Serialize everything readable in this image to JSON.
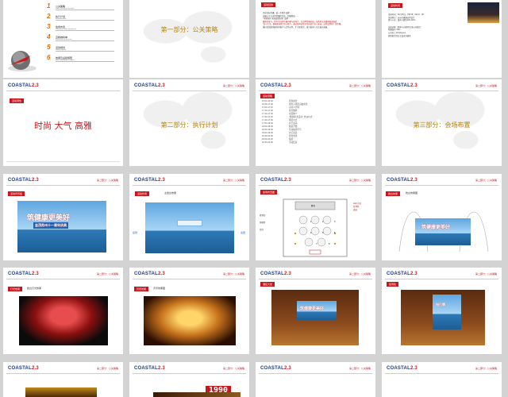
{
  "logo": {
    "main": "COASTAL",
    "suffix": "2.3"
  },
  "section_label": "第二部分：公关策略",
  "slide1": {
    "menu": [
      {
        "num": "1",
        "label": "公关策略",
        "sub": "Public Relations strategies"
      },
      {
        "num": "2",
        "label": "执行计划",
        "sub": "Implementation"
      },
      {
        "num": "3",
        "label": "会场布置",
        "sub": "Conference hall arrangement"
      },
      {
        "num": "4",
        "label": "宣教物料单",
        "sub": "Production of materials"
      },
      {
        "num": "5",
        "label": "活动规划",
        "sub": "Event program"
      },
      {
        "num": "6",
        "label": "效果及后勤保障",
        "sub": "Effect and logistics support"
      }
    ]
  },
  "slide2": {
    "title": "第一部分：公关策略"
  },
  "slide3": {
    "badge": "活动目的",
    "lines": [
      "活动目标传播：进一步提升品牌……",
      "加强公关与市场传播的互动，积极参加……",
      "\"中国海岸·滨海度假名城\" 品牌……",
      "媒体的参与，提升活动的传播声量与影响力，在品牌传播层面，由各地主流媒体跟进报道",
      "\"宜人生活，健康新天地\" 的主题下，通过各种途径对活动进行深入报道，达到品牌的广泛传播。",
      "通过活动影响更多的客户与合作伙伴，扩大影响力，吸引更多人关注城市发展。"
    ]
  },
  "slide4": {
    "badge": "活动时间",
    "time": "活动时间：11月16日，PM:16：00-21：00",
    "place": "活动地点：苏州万豪酒店宴会厅",
    "count": "参与人员：嘉宾人数约100-120人",
    "target_title": "出席对象（具体人员参考金茂公司指定）",
    "targets": [
      "特邀嘉宾 VIPs",
      "公司员工 Employees",
      "其他指定的业主及来宾嘉宾"
    ]
  },
  "slide5": {
    "badge": "活动调性",
    "title": "时尚 大气 高雅"
  },
  "slide6": {
    "title": "第二部分：执行计划"
  },
  "slide7": {
    "badge": "活动流程",
    "rows": [
      [
        "16:00-16:30",
        "签到迎宾"
      ],
      [
        "16:30-17:00",
        "嘉宾入场及自由交流"
      ],
      [
        "17:00-17:10",
        "主持人开场"
      ],
      [
        "17:10-17:20",
        "领导致辞"
      ],
      [
        "17:20-17:30",
        "项目推介"
      ],
      [
        "17:30-17:40",
        "\"筑健康 更美好\" 启动仪式"
      ],
      [
        "17:40-17:50",
        "颁奖仪式"
      ],
      [
        "17:50-18:00",
        "文艺表演"
      ],
      [
        "18:00-18:30",
        "晚宴开始"
      ],
      [
        "18:30-19:00",
        "互动抽奖环节"
      ],
      [
        "19:00-19:30",
        "文艺表演"
      ],
      [
        "19:30-20:00",
        "嘉宾交流"
      ],
      [
        "20:00-20:30",
        "抽奖"
      ],
      [
        "20:30-21:00",
        "活动结束"
      ]
    ]
  },
  "slide8": {
    "title": "第三部分：会场布置"
  },
  "slide9": {
    "badge": "活动背景板",
    "banner_big": "筑健康更美好",
    "banner_small": "金茂苏州十一周年庆典"
  },
  "slide10": {
    "badge": "活动外场",
    "sub": "主舞台效果",
    "left_label": "签到",
    "right_label": "迎宾"
  },
  "slide11": {
    "badge": "会场布置图",
    "stage_label": "舞台",
    "legend": [
      "LED大屏",
      "签到区",
      "通道"
    ],
    "tables": [
      "1",
      "2",
      "3",
      "4",
      "5",
      "6",
      "7",
      "8"
    ],
    "labels": [
      "签到台",
      "茶歇区",
      "音控"
    ]
  },
  "slide12": {
    "badge": "舞台效果",
    "sub": "舞台效果图"
  },
  "slide13": {
    "badge": "灯光效果",
    "sub": "舞台灯光效果"
  },
  "slide14": {
    "badge": "背景效果",
    "sub": "背景效果图"
  },
  "slide15": {
    "badge": "酒店大堂",
    "banner": "筑健康更美好"
  },
  "slide16": {
    "badge": "签到处",
    "banner": "指引牌"
  },
  "slide19": {
    "year": "1990"
  }
}
